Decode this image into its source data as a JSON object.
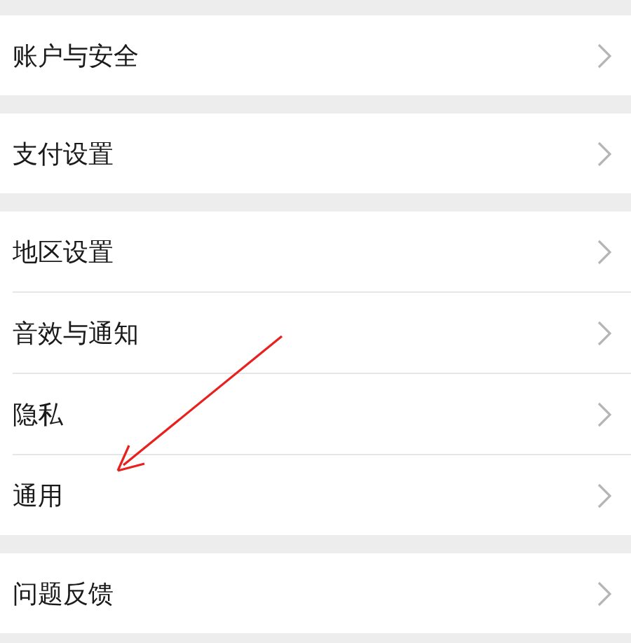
{
  "groups": [
    {
      "items": [
        {
          "label": "账户与安全"
        }
      ]
    },
    {
      "items": [
        {
          "label": "支付设置"
        }
      ]
    },
    {
      "items": [
        {
          "label": "地区设置"
        },
        {
          "label": "音效与通知"
        },
        {
          "label": "隐私"
        },
        {
          "label": "通用"
        }
      ]
    },
    {
      "items": [
        {
          "label": "问题反馈"
        }
      ]
    }
  ],
  "annotation": {
    "kind": "arrow"
  }
}
